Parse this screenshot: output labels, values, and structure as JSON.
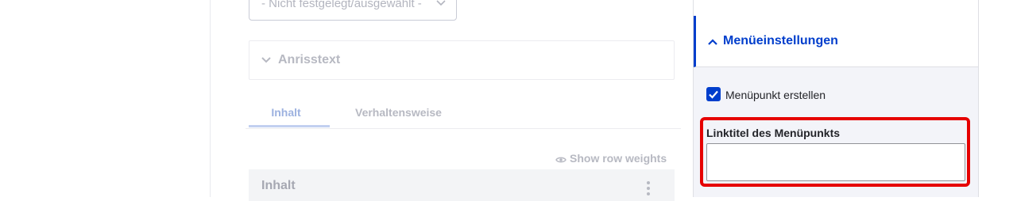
{
  "main": {
    "select": {
      "value": "- Nicht festgelegt/ausgewählt -"
    },
    "anrisstext": {
      "label": "Anrisstext"
    },
    "tabs": [
      {
        "label": "Inhalt",
        "active": true
      },
      {
        "label": "Verhaltensweise",
        "active": false
      }
    ],
    "show_row_weights": "Show row weights",
    "row": {
      "label": "Inhalt"
    }
  },
  "sidebar": {
    "menu_settings": {
      "title": "Menüeinstellungen",
      "expanded": true
    },
    "create_menu_item": {
      "label": "Menüpunkt erstellen",
      "checked": true
    },
    "link_title": {
      "label": "Linktitel des Menüpunkts",
      "value": ""
    }
  },
  "colors": {
    "accent": "#003ecc",
    "highlight": "#e60000",
    "sidebar_bg": "#f3f4f9"
  }
}
